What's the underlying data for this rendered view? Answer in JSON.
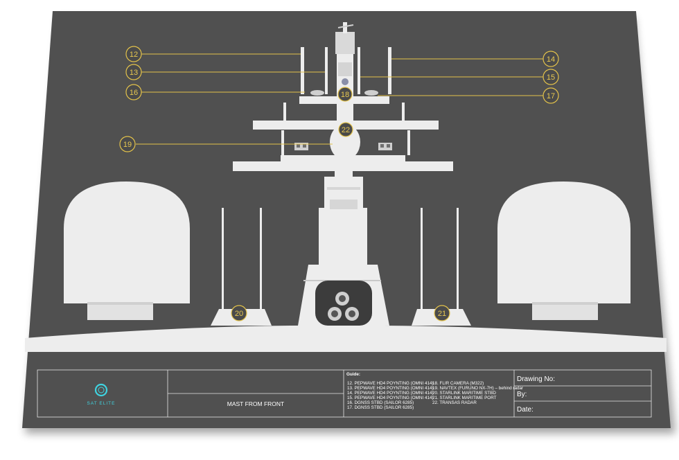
{
  "drawing": {
    "callouts": [
      "12",
      "13",
      "14",
      "15",
      "16",
      "17",
      "18",
      "19",
      "20",
      "21",
      "22"
    ],
    "accent_color": "#e3c24a",
    "sheet_color": "#505050",
    "equipment_color": "#ededed"
  },
  "title_block": {
    "logo_text": "SAT ELITE",
    "title": "MAST FROM FRONT",
    "guide_heading": "Guide:",
    "guide_col1": [
      "12. PEPWAVE HD4 POYNTING (OMNI 414)",
      "13. PEPWAVE HD4 POYNTING (OMNI 414)",
      "14. PEPWAVE HD4 POYNTING (OMNI 414)",
      "15. PEPWAVE HD4 POYNTING (OMNI 414)",
      "16. DGNSS STBD (SAILOR 6285)",
      "17. DGNSS STBD (SAILOR 6285)"
    ],
    "guide_col2": [
      "18. FLIR CAMERA (M322)",
      "19. NAVTEX (FURUNO NX-7H) – behind radar",
      "20. STARLINK MARITIME STBD",
      "21. STARLINK MARITIME PORT",
      "22. TRANSAS RADAR"
    ],
    "drawing_no_label": "Drawing No:",
    "by_label": "By:",
    "date_label": "Date:"
  }
}
